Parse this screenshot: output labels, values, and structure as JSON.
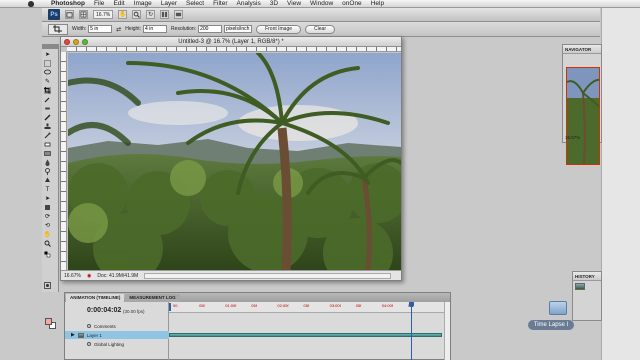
{
  "menubar": {
    "app_name": "Photoshop",
    "items": [
      "File",
      "Edit",
      "Image",
      "Layer",
      "Select",
      "Filter",
      "Analysis",
      "3D",
      "View",
      "Window",
      "onOne",
      "Help"
    ]
  },
  "appbar": {
    "logo": "Ps",
    "zoom_value": "16.7%",
    "icons": [
      "launch-bridge-icon",
      "view-extras-icon",
      "hand-icon",
      "zoom-icon",
      "rotate-view-icon",
      "arrange-documents-icon",
      "screen-mode-icon"
    ]
  },
  "options": {
    "width_label": "Width:",
    "width_value": "5 in",
    "height_label": "Height:",
    "height_value": "4 in",
    "resolution_label": "Resolution:",
    "resolution_value": "200",
    "resolution_unit": "pixels/inch",
    "front_image_button": "Front Image",
    "clear_button": "Clear"
  },
  "document": {
    "title": "Untitled-3 @ 16.7% (Layer 1, RGB/8*) *",
    "zoom": "16.67%",
    "doc_size": "Doc: 41.9M/41.9M"
  },
  "navigator": {
    "tab": "NAVIGATOR",
    "zoom": "16.67%"
  },
  "history": {
    "tab": "HISTORY"
  },
  "desktop": {
    "folder_label": "Time Lapse I"
  },
  "timeline": {
    "tab_active": "ANIMATION (TIMELINE)",
    "tab_inactive": "MEASUREMENT LOG",
    "current_time": "0:00:04:02",
    "fps": "(30.00 fps)",
    "rows": [
      {
        "label": "Comments",
        "selected": false
      },
      {
        "label": "Layer 1",
        "selected": true
      },
      {
        "label": "Global Lighting",
        "selected": false
      }
    ],
    "ruler_marks": [
      "00",
      "05f",
      "01:00f",
      "05f",
      "02:00f",
      "05f",
      "03:00f",
      "05f",
      "04:00f",
      "05f"
    ],
    "playhead_fraction": 0.88,
    "bar_fraction": 1.0
  },
  "colors": {
    "timeline_bar": "#4fa3a0",
    "playhead": "#2b5fa8",
    "selected_row": "#8fc5e3",
    "foreground_swatch": "#f0a8a0"
  }
}
